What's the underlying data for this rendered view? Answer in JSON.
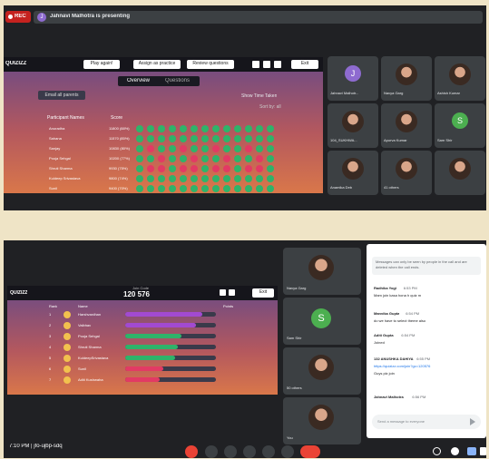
{
  "top": {
    "rec_label": "REC",
    "presenter_initial": "J",
    "presenter_text": "Jahnavi Malhotra is presenting",
    "quiz": {
      "logo": "QUIZIZZ",
      "buttons": [
        "Play again!",
        "Assign as practice",
        "Review questions"
      ],
      "exit_label": "Exit",
      "tabs": [
        "Overview",
        "Questions"
      ],
      "email_btn": "Email all parents",
      "show_time": "Show Time Taken",
      "sort_label": "Sort by: all",
      "col_participant": "Participant Names",
      "col_score": "Score",
      "rows": [
        {
          "name": "Anuradha",
          "score": "11800 (88%)"
        },
        {
          "name": "Sahana",
          "score": "11570 (85%)"
        },
        {
          "name": "Sanjay",
          "score": "10830 (80%)"
        },
        {
          "name": "Pooja Sehgal",
          "score": "10200 (77%)"
        },
        {
          "name": "Shruti Sharma",
          "score": "9930 (75%)"
        },
        {
          "name": "Kuldeep Srivastava",
          "score": "9800 (74%)"
        },
        {
          "name": "Sunil",
          "score": "9400 (70%)"
        }
      ]
    },
    "participants": [
      {
        "name": "Jahnavi Malhotr...",
        "initial": "J",
        "color": "#8e6bd0"
      },
      {
        "name": "Navya Garg"
      },
      {
        "name": "Ashish Kumar"
      },
      {
        "name": "104_SUKHWA..."
      },
      {
        "name": "Apurva Kumar"
      },
      {
        "name": "Sam Shir",
        "initial": "S",
        "color": "#4caf50"
      },
      {
        "name": "Anamika Deb"
      },
      {
        "name": "41 others"
      },
      {
        "name": ""
      }
    ]
  },
  "bottom": {
    "quiz": {
      "logo": "QUIZIZZ",
      "join_code_label": "Join Code",
      "join_code": "120 576",
      "exit_label": "Exit",
      "col_rank": "Rank",
      "col_name": "Name",
      "col_points": "Points",
      "rows": [
        {
          "rank": "1",
          "name": "Harshvardhan",
          "fill": 0.85,
          "color": "#a24ad1"
        },
        {
          "rank": "2",
          "name": "Vaibhav",
          "fill": 0.78,
          "color": "#a24ad1"
        },
        {
          "rank": "3",
          "name": "Pooja Sehgal",
          "fill": 0.62,
          "color": "#2fb36a"
        },
        {
          "rank": "4",
          "name": "Shruti Sharma",
          "fill": 0.58,
          "color": "#2fb36a"
        },
        {
          "rank": "5",
          "name": "KuldeepSrivastava",
          "fill": 0.55,
          "color": "#2fb36a"
        },
        {
          "rank": "6",
          "name": "Sunil",
          "fill": 0.42,
          "color": "#e23a64"
        },
        {
          "rank": "7",
          "name": "Aditi Kushwaha",
          "fill": 0.38,
          "color": "#e23a64"
        }
      ]
    },
    "participants": [
      {
        "name": "Navya Garg"
      },
      {
        "name": "Sam Shir",
        "initial": "S",
        "color": "#4caf50"
      },
      {
        "name": "50 others"
      },
      {
        "name": "You"
      }
    ],
    "chat": {
      "header": "Messages can only be seen by people in the call and are deleted when the call ends.",
      "messages": [
        {
          "sender": "Radhika Yogi",
          "time": "6:53 PM",
          "text": "Mam join kasa hona h quiz m"
        },
        {
          "sender": "Manvika Gupta",
          "time": "6:54 PM",
          "text": "do we have to select theme also"
        },
        {
          "sender": "Aditi Gupta",
          "time": "6:54 PM",
          "text": "Joined"
        },
        {
          "sender": "132 ANUSHKA DAHIYA",
          "time": "6:55 PM",
          "text": "https://quizizz.com/join?gc=120576"
        },
        {
          "sender": "",
          "time": "",
          "text": "Guys plz join"
        },
        {
          "sender": "Jahnavi Malhotra",
          "time": "6:56 PM",
          "text": ""
        }
      ],
      "input_placeholder": "Send a message to everyone"
    },
    "footer": {
      "time_code": "7:10 PM  |  jfo-ujbp-sdq"
    }
  }
}
